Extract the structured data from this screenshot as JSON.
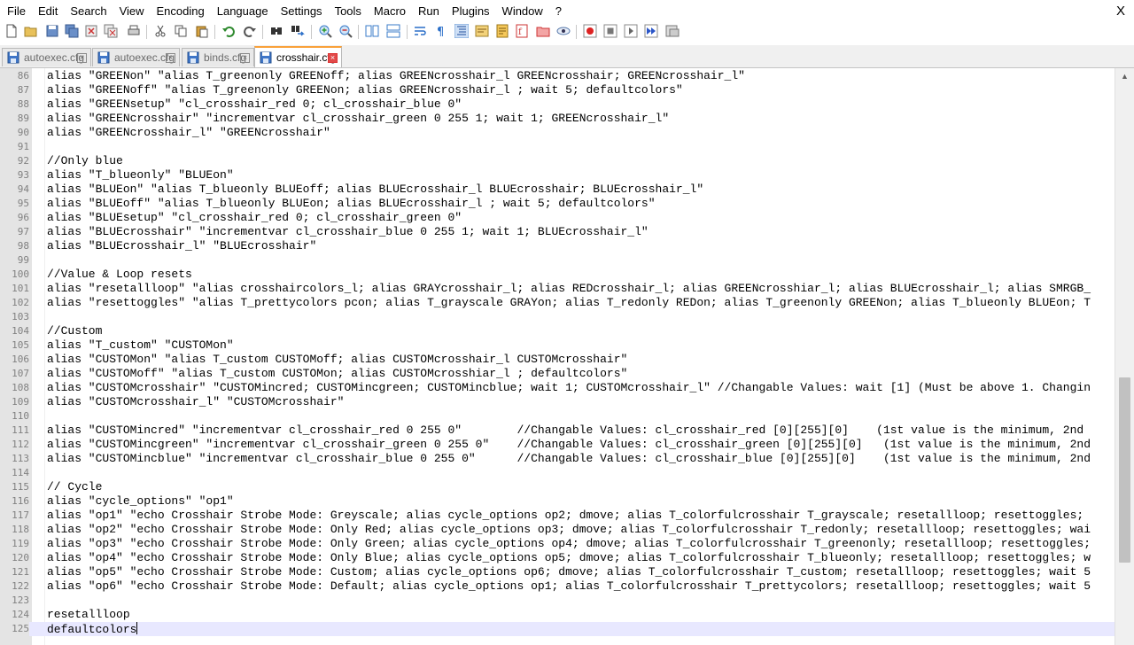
{
  "menu": {
    "items": [
      "File",
      "Edit",
      "Search",
      "View",
      "Encoding",
      "Language",
      "Settings",
      "Tools",
      "Macro",
      "Run",
      "Plugins",
      "Window",
      "?"
    ],
    "close": "X"
  },
  "toolbar": {
    "buttons": [
      "new-file",
      "open-file",
      "save",
      "save-all",
      "close",
      "close-all",
      "print",
      "cut",
      "copy",
      "paste",
      "undo",
      "redo",
      "find",
      "replace",
      "zoom-in",
      "zoom-out",
      "sync-vertical",
      "sync-horizontal",
      "word-wrap",
      "show-all-characters",
      "indent-guide",
      "define-language",
      "document-map",
      "function-list",
      "folder-as-workspace",
      "monitoring",
      "record-macro",
      "stop-recording",
      "playback-macro",
      "run-macro-multiple",
      "save-macro"
    ]
  },
  "tabs": [
    {
      "label": "autoexec.cfg",
      "active": false
    },
    {
      "label": "autoexec.cfg",
      "active": false
    },
    {
      "label": "binds.cfg",
      "active": false
    },
    {
      "label": "crosshair.cfg",
      "active": true
    }
  ],
  "editor": {
    "current_line": 125,
    "lines": [
      {
        "n": "86",
        "text": "alias \"GREENon\" \"alias T_greenonly GREENoff; alias GREENcrosshair_l GREENcrosshair; GREENcrosshair_l\""
      },
      {
        "n": "87",
        "text": "alias \"GREENoff\" \"alias T_greenonly GREENon; alias GREENcrosshair_l ; wait 5; defaultcolors\""
      },
      {
        "n": "88",
        "text": "alias \"GREENsetup\" \"cl_crosshair_red 0; cl_crosshair_blue 0\""
      },
      {
        "n": "89",
        "text": "alias \"GREENcrosshair\" \"incrementvar cl_crosshair_green 0 255 1; wait 1; GREENcrosshair_l\""
      },
      {
        "n": "90",
        "text": "alias \"GREENcrosshair_l\" \"GREENcrosshair\""
      },
      {
        "n": "91",
        "text": ""
      },
      {
        "n": "92",
        "text": "//Only blue"
      },
      {
        "n": "93",
        "text": "alias \"T_blueonly\" \"BLUEon\""
      },
      {
        "n": "94",
        "text": "alias \"BLUEon\" \"alias T_blueonly BLUEoff; alias BLUEcrosshair_l BLUEcrosshair; BLUEcrosshair_l\""
      },
      {
        "n": "95",
        "text": "alias \"BLUEoff\" \"alias T_blueonly BLUEon; alias BLUEcrosshair_l ; wait 5; defaultcolors\""
      },
      {
        "n": "96",
        "text": "alias \"BLUEsetup\" \"cl_crosshair_red 0; cl_crosshair_green 0\""
      },
      {
        "n": "97",
        "text": "alias \"BLUEcrosshair\" \"incrementvar cl_crosshair_blue 0 255 1; wait 1; BLUEcrosshair_l\""
      },
      {
        "n": "98",
        "text": "alias \"BLUEcrosshair_l\" \"BLUEcrosshair\""
      },
      {
        "n": "99",
        "text": ""
      },
      {
        "n": "100",
        "text": "//Value & Loop resets"
      },
      {
        "n": "101",
        "text": "alias \"resetallloop\" \"alias crosshaircolors_l; alias GRAYcrosshair_l; alias REDcrosshair_l; alias GREENcrosshiar_l; alias BLUEcrosshair_l; alias SMRGB_"
      },
      {
        "n": "102",
        "text": "alias \"resettoggles\" \"alias T_prettycolors pcon; alias T_grayscale GRAYon; alias T_redonly REDon; alias T_greenonly GREENon; alias T_blueonly BLUEon; T"
      },
      {
        "n": "103",
        "text": ""
      },
      {
        "n": "104",
        "text": "//Custom"
      },
      {
        "n": "105",
        "text": "alias \"T_custom\" \"CUSTOMon\""
      },
      {
        "n": "106",
        "text": "alias \"CUSTOMon\" \"alias T_custom CUSTOMoff; alias CUSTOMcrosshair_l CUSTOMcrosshair\""
      },
      {
        "n": "107",
        "text": "alias \"CUSTOMoff\" \"alias T_custom CUSTOMon; alias CUSTOMcrosshiar_l ; defaultcolors\""
      },
      {
        "n": "108",
        "text": "alias \"CUSTOMcrosshair\" \"CUSTOMincred; CUSTOMincgreen; CUSTOMincblue; wait 1; CUSTOMcrosshair_l\" //Changable Values: wait [1] (Must be above 1. Changin"
      },
      {
        "n": "109",
        "text": "alias \"CUSTOMcrosshair_l\" \"CUSTOMcrosshair\""
      },
      {
        "n": "110",
        "text": ""
      },
      {
        "n": "111",
        "text": "alias \"CUSTOMincred\" \"incrementvar cl_crosshair_red 0 255 0\"        //Changable Values: cl_crosshair_red [0][255][0]    (1st value is the minimum, 2nd"
      },
      {
        "n": "112",
        "text": "alias \"CUSTOMincgreen\" \"incrementvar cl_crosshair_green 0 255 0\"    //Changable Values: cl_crosshair_green [0][255][0]   (1st value is the minimum, 2nd"
      },
      {
        "n": "113",
        "text": "alias \"CUSTOMincblue\" \"incrementvar cl_crosshair_blue 0 255 0\"      //Changable Values: cl_crosshair_blue [0][255][0]    (1st value is the minimum, 2nd"
      },
      {
        "n": "114",
        "text": ""
      },
      {
        "n": "115",
        "text": "// Cycle"
      },
      {
        "n": "116",
        "text": "alias \"cycle_options\" \"op1\""
      },
      {
        "n": "117",
        "text": "alias \"op1\" \"echo Crosshair Strobe Mode: Greyscale; alias cycle_options op2; dmove; alias T_colorfulcrosshair T_grayscale; resetallloop; resettoggles; "
      },
      {
        "n": "118",
        "text": "alias \"op2\" \"echo Crosshair Strobe Mode: Only Red; alias cycle_options op3; dmove; alias T_colorfulcrosshair T_redonly; resetallloop; resettoggles; wai"
      },
      {
        "n": "119",
        "text": "alias \"op3\" \"echo Crosshair Strobe Mode: Only Green; alias cycle_options op4; dmove; alias T_colorfulcrosshair T_greenonly; resetallloop; resettoggles;"
      },
      {
        "n": "120",
        "text": "alias \"op4\" \"echo Crosshair Strobe Mode: Only Blue; alias cycle_options op5; dmove; alias T_colorfulcrosshair T_blueonly; resetallloop; resettoggles; w"
      },
      {
        "n": "121",
        "text": "alias \"op5\" \"echo Crosshair Strobe Mode: Custom; alias cycle_options op6; dmove; alias T_colorfulcrosshair T_custom; resetallloop; resettoggles; wait 5"
      },
      {
        "n": "122",
        "text": "alias \"op6\" \"echo Crosshair Strobe Mode: Default; alias cycle_options op1; alias T_colorfulcrosshair T_prettycolors; resetallloop; resettoggles; wait 5"
      },
      {
        "n": "123",
        "text": ""
      },
      {
        "n": "124",
        "text": "resetallloop"
      },
      {
        "n": "125",
        "text": "defaultcolors"
      }
    ]
  },
  "scrollbar": {
    "position": 0.78,
    "visible_fraction": 0.33
  }
}
